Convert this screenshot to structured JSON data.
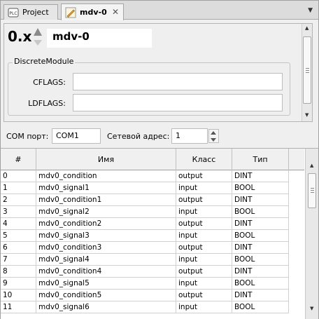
{
  "tabs": [
    {
      "label": "Project",
      "icon": "plc-icon",
      "active": false
    },
    {
      "label": "mdv-0",
      "icon": "pencil-icon",
      "active": true
    }
  ],
  "header": {
    "index_prefix": "0.x",
    "module_name": "mdv-0"
  },
  "group": {
    "title": "DiscreteModule",
    "fields": [
      {
        "label": "CFLAGS:",
        "value": ""
      },
      {
        "label": "LDFLAGS:",
        "value": ""
      }
    ]
  },
  "com": {
    "port_label": "COM порт:",
    "port_value": "COM1",
    "address_label": "Сетевой адрес:",
    "address_value": "1"
  },
  "table": {
    "columns": [
      "#",
      "Имя",
      "Класс",
      "Тип"
    ],
    "rows": [
      [
        "0",
        "mdv0_condition",
        "output",
        "DINT"
      ],
      [
        "1",
        "mdv0_signal1",
        "input",
        "BOOL"
      ],
      [
        "2",
        "mdv0_condition1",
        "output",
        "DINT"
      ],
      [
        "3",
        "mdv0_signal2",
        "input",
        "BOOL"
      ],
      [
        "4",
        "mdv0_condition2",
        "output",
        "DINT"
      ],
      [
        "5",
        "mdv0_signal3",
        "input",
        "BOOL"
      ],
      [
        "6",
        "mdv0_condition3",
        "output",
        "DINT"
      ],
      [
        "7",
        "mdv0_signal4",
        "input",
        "BOOL"
      ],
      [
        "8",
        "mdv0_condition4",
        "output",
        "DINT"
      ],
      [
        "9",
        "mdv0_signal5",
        "input",
        "BOOL"
      ],
      [
        "10",
        "mdv0_condition5",
        "output",
        "DINT"
      ],
      [
        "11",
        "mdv0_signal6",
        "input",
        "BOOL"
      ]
    ]
  }
}
